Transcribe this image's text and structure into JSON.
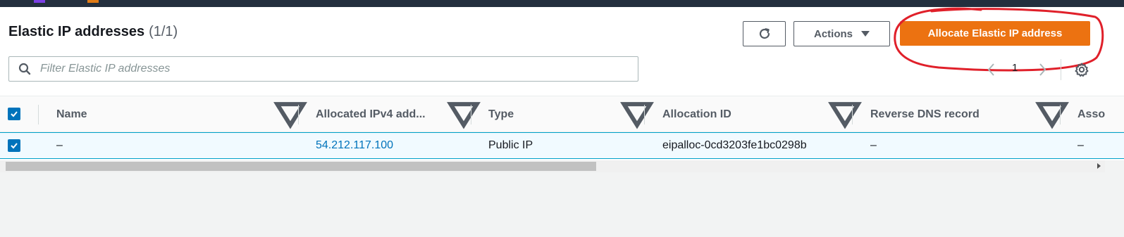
{
  "header": {
    "title": "Elastic IP addresses",
    "count": "(1/1)"
  },
  "toolbar": {
    "actions_label": "Actions",
    "allocate_label": "Allocate Elastic IP address"
  },
  "search": {
    "placeholder": "Filter Elastic IP addresses"
  },
  "pagination": {
    "current_page": "1"
  },
  "table": {
    "columns": [
      "Name",
      "Allocated IPv4 add...",
      "Type",
      "Allocation ID",
      "Reverse DNS record",
      "Asso"
    ],
    "rows": [
      {
        "selected": true,
        "name": "–",
        "allocated_ipv4": "54.212.117.100",
        "type": "Public IP",
        "allocation_id": "eipalloc-0cd3203fe1bc0298b",
        "reverse_dns": "–",
        "association": "–"
      }
    ]
  },
  "icons": {
    "refresh": "refresh-icon",
    "search": "search-icon",
    "settings": "gear-icon",
    "prev": "chevron-left-icon",
    "next": "chevron-right-icon",
    "sort": "sort-down-icon"
  },
  "colors": {
    "primary_button": "#ec7211",
    "link": "#0073bb",
    "selected_row": "#f1faff",
    "annotation": "#e0202a"
  }
}
